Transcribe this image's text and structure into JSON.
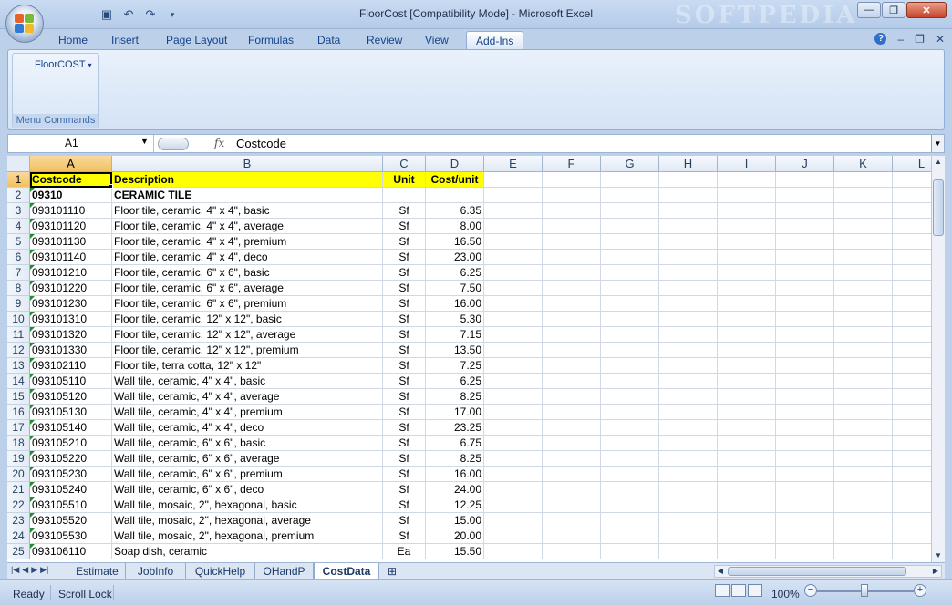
{
  "window": {
    "title": "FloorCost  [Compatibility Mode] - Microsoft Excel",
    "watermark": "SOFTPEDIA",
    "minimize_label": "—",
    "restore_label": "❐",
    "close_label": "✕"
  },
  "quick_access": {
    "save_icon": "save-icon",
    "undo_icon": "undo-icon",
    "redo_icon": "redo-icon"
  },
  "ribbon": {
    "tabs": [
      "Home",
      "Insert",
      "Page Layout",
      "Formulas",
      "Data",
      "Review",
      "View",
      "Add-Ins"
    ],
    "active_tab": "Add-Ins",
    "group": {
      "button_label": "FloorCOST",
      "label": "Menu Commands"
    }
  },
  "formula_bar": {
    "name_box": "A1",
    "fx_label": "fx",
    "value": "Costcode"
  },
  "columns": [
    "A",
    "B",
    "C",
    "D",
    "E",
    "F",
    "G",
    "H",
    "I",
    "J",
    "K",
    "L"
  ],
  "rows": [
    {
      "n": "1",
      "a": "Costcode",
      "b": "Description",
      "c": "Unit",
      "d": "Cost/unit"
    },
    {
      "n": "2",
      "a": "09310",
      "b": "CERAMIC TILE",
      "c": "",
      "d": ""
    },
    {
      "n": "3",
      "a": "093101110",
      "b": "Floor tile, ceramic, 4\" x 4\", basic",
      "c": "Sf",
      "d": "6.35"
    },
    {
      "n": "4",
      "a": "093101120",
      "b": "Floor tile, ceramic, 4\" x 4\", average",
      "c": "Sf",
      "d": "8.00"
    },
    {
      "n": "5",
      "a": "093101130",
      "b": "Floor tile, ceramic, 4\" x 4\", premium",
      "c": "Sf",
      "d": "16.50"
    },
    {
      "n": "6",
      "a": "093101140",
      "b": "Floor tile, ceramic, 4\" x 4\", deco",
      "c": "Sf",
      "d": "23.00"
    },
    {
      "n": "7",
      "a": "093101210",
      "b": "Floor tile, ceramic, 6\" x 6\", basic",
      "c": "Sf",
      "d": "6.25"
    },
    {
      "n": "8",
      "a": "093101220",
      "b": "Floor tile, ceramic, 6\" x 6\", average",
      "c": "Sf",
      "d": "7.50"
    },
    {
      "n": "9",
      "a": "093101230",
      "b": "Floor tile, ceramic, 6\" x 6\", premium",
      "c": "Sf",
      "d": "16.00"
    },
    {
      "n": "10",
      "a": "093101310",
      "b": "Floor tile, ceramic, 12\" x 12\", basic",
      "c": "Sf",
      "d": "5.30"
    },
    {
      "n": "11",
      "a": "093101320",
      "b": "Floor tile, ceramic, 12\" x 12\", average",
      "c": "Sf",
      "d": "7.15"
    },
    {
      "n": "12",
      "a": "093101330",
      "b": "Floor tile, ceramic, 12\" x 12\", premium",
      "c": "Sf",
      "d": "13.50"
    },
    {
      "n": "13",
      "a": "093102110",
      "b": "Floor tile, terra cotta, 12\" x 12\"",
      "c": "Sf",
      "d": "7.25"
    },
    {
      "n": "14",
      "a": "093105110",
      "b": "Wall tile, ceramic, 4\" x 4\", basic",
      "c": "Sf",
      "d": "6.25"
    },
    {
      "n": "15",
      "a": "093105120",
      "b": "Wall tile, ceramic, 4\" x 4\", average",
      "c": "Sf",
      "d": "8.25"
    },
    {
      "n": "16",
      "a": "093105130",
      "b": "Wall tile, ceramic, 4\" x 4\", premium",
      "c": "Sf",
      "d": "17.00"
    },
    {
      "n": "17",
      "a": "093105140",
      "b": "Wall tile, ceramic, 4\" x 4\", deco",
      "c": "Sf",
      "d": "23.25"
    },
    {
      "n": "18",
      "a": "093105210",
      "b": "Wall tile, ceramic, 6\" x 6\", basic",
      "c": "Sf",
      "d": "6.75"
    },
    {
      "n": "19",
      "a": "093105220",
      "b": "Wall tile, ceramic, 6\" x 6\", average",
      "c": "Sf",
      "d": "8.25"
    },
    {
      "n": "20",
      "a": "093105230",
      "b": "Wall tile, ceramic, 6\" x 6\", premium",
      "c": "Sf",
      "d": "16.00"
    },
    {
      "n": "21",
      "a": "093105240",
      "b": "Wall tile, ceramic, 6\" x 6\", deco",
      "c": "Sf",
      "d": "24.00"
    },
    {
      "n": "22",
      "a": "093105510",
      "b": "Wall tile, mosaic, 2\", hexagonal, basic",
      "c": "Sf",
      "d": "12.25"
    },
    {
      "n": "23",
      "a": "093105520",
      "b": "Wall tile, mosaic, 2\", hexagonal, average",
      "c": "Sf",
      "d": "15.00"
    },
    {
      "n": "24",
      "a": "093105530",
      "b": "Wall tile, mosaic, 2\", hexagonal, premium",
      "c": "Sf",
      "d": "20.00"
    },
    {
      "n": "25",
      "a": "093106110",
      "b": "Soap dish, ceramic",
      "c": "Ea",
      "d": "15.50"
    }
  ],
  "sheet_tabs": [
    "Estimate",
    "JobInfo",
    "QuickHelp",
    "OHandP",
    "CostData"
  ],
  "active_sheet": "CostData",
  "status_bar": {
    "mode": "Ready",
    "scroll_lock": "Scroll Lock",
    "zoom": "100%"
  },
  "colors": {
    "header_fill": "#ffff00",
    "selection": "#f1c15f",
    "ribbon": "#d4e3f5"
  }
}
